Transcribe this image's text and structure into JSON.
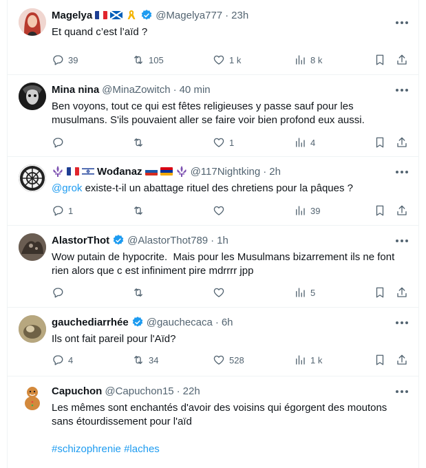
{
  "posts": [
    {
      "name": "Magelya",
      "handle": "@Magelya777",
      "time": "23h",
      "verified": true,
      "text_lines": [
        "Et quand c’est l’aïd ?"
      ],
      "replies": "39",
      "reposts": "105",
      "likes": "1 k",
      "views": "8 k",
      "avatar_color": "#c0504d"
    },
    {
      "name": "Mina nina",
      "handle": "@MinaZowitch",
      "time": "40 min",
      "verified": false,
      "text_lines": [
        "Ben voyons, tout ce qui est fêtes religieuses y passe sauf pour les",
        "musulmans. S'ils pouvaient aller se faire voir bien profond eux aussi."
      ],
      "replies": "",
      "reposts": "",
      "likes": "1",
      "views": "4",
      "avatar_color": "#3a3a3a"
    },
    {
      "name": "Wođanaz",
      "handle": "@117Nightking",
      "time": "2h",
      "verified": false,
      "mention": "@grok",
      "text_rest": " existe-t-il un abattage rituel des chretiens pour la pâques ?",
      "replies": "1",
      "reposts": "",
      "likes": "",
      "views": "39",
      "avatar_color": "#222222"
    },
    {
      "name": "AlastorThot",
      "handle": "@AlastorThot789",
      "time": "1h",
      "verified": true,
      "text_lines": [
        "Wow putain de hypocrite.  Mais pour les Musulmans bizarrement ils ne font",
        "rien alors que c est infiniment pire mdrrrr jpp"
      ],
      "replies": "",
      "reposts": "",
      "likes": "",
      "views": "5",
      "avatar_color": "#5b5148"
    },
    {
      "name": "gauchediarrhée",
      "handle": "@gauchecaca",
      "time": "6h",
      "verified": true,
      "text_lines": [
        "Ils ont fait pareil pour l'Aïd?"
      ],
      "replies": "4",
      "reposts": "34",
      "likes": "528",
      "views": "1 k",
      "avatar_color": "#8a7b5a"
    },
    {
      "name": "Capuchon",
      "handle": "@Capuchon15",
      "time": "22h",
      "verified": false,
      "text_lines": [
        "Les mêmes sont enchantés d'avoir des voisins qui égorgent des moutons",
        "sans étourdissement pour l'aïd"
      ],
      "hashtags": [
        "#schizophrenie",
        "#laches"
      ],
      "avatar_color": "#d89a4a"
    }
  ],
  "separator": "·"
}
